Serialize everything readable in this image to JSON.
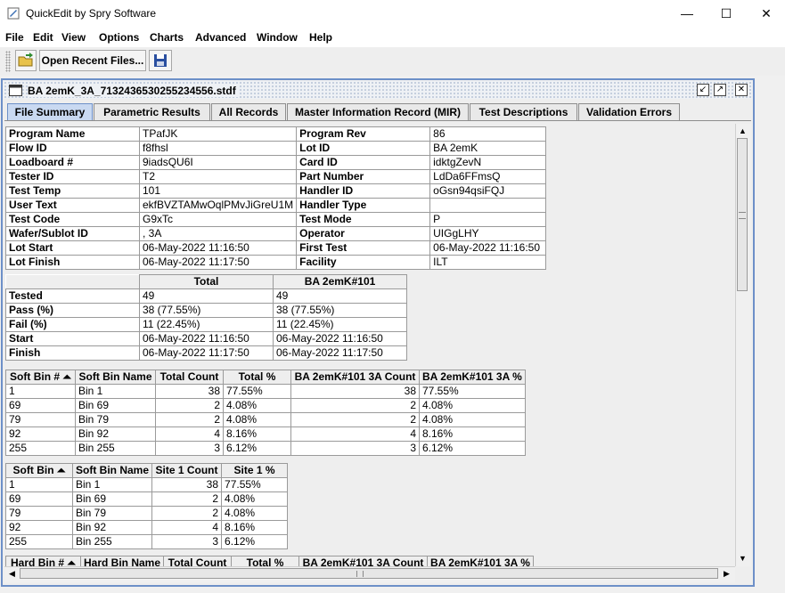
{
  "window": {
    "title": "QuickEdit by Spry Software",
    "minimize": "—",
    "maximize": "☐",
    "close": "✕"
  },
  "menu": [
    "File",
    "Edit",
    "View",
    "Options",
    "Charts",
    "Advanced",
    "Window",
    "Help"
  ],
  "toolbar": {
    "open_recent_label": "Open Recent Files..."
  },
  "frame": {
    "title": "BA 2emK_3A_7132436530255234556.stdf"
  },
  "tabs": [
    "File Summary",
    "Parametric Results",
    "All Records",
    "Master Information Record (MIR)",
    "Test Descriptions",
    "Validation Errors"
  ],
  "mir": {
    "rows": [
      [
        "Program Name",
        "TPafJK",
        "Program Rev",
        "86"
      ],
      [
        "Flow ID",
        "f8fhsl",
        "Lot ID",
        "BA 2emK"
      ],
      [
        "Loadboard #",
        "9iadsQU6I",
        "Card ID",
        "idktgZevN"
      ],
      [
        "Tester ID",
        "T2",
        "Part Number",
        "LdDa6FFmsQ"
      ],
      [
        "Test Temp",
        "101",
        "Handler ID",
        "oGsn94qsiFQJ"
      ],
      [
        "User Text",
        "ekfBVZTAMwOqlPMvJiGreU1M",
        "Handler Type",
        ""
      ],
      [
        "Test Code",
        "G9xTc",
        "Test Mode",
        "P"
      ],
      [
        "Wafer/Sublot ID",
        ", 3A",
        "Operator",
        "UIGgLHY"
      ],
      [
        "Lot Start",
        "06-May-2022 11:16:50",
        "First Test",
        "06-May-2022 11:16:50"
      ],
      [
        "Lot Finish",
        "06-May-2022 11:17:50",
        "Facility",
        "ILT"
      ]
    ]
  },
  "summary": {
    "headers": [
      "",
      "Total",
      "BA 2emK#101"
    ],
    "rows": [
      [
        "Tested",
        "49",
        "49"
      ],
      [
        "Pass (%)",
        "38 (77.55%)",
        "38 (77.55%)"
      ],
      [
        "Fail (%)",
        "11 (22.45%)",
        "11 (22.45%)"
      ],
      [
        "Start",
        "06-May-2022 11:16:50",
        "06-May-2022 11:16:50"
      ],
      [
        "Finish",
        "06-May-2022 11:17:50",
        "06-May-2022 11:17:50"
      ]
    ]
  },
  "softbin1": {
    "headers": [
      "Soft Bin # ⏶",
      "Soft Bin Name",
      "Total Count",
      "Total %",
      "BA 2emK#101 3A Count",
      "BA 2emK#101 3A %"
    ],
    "rows": [
      [
        "1",
        "Bin 1",
        "38",
        "77.55%",
        "38",
        "77.55%"
      ],
      [
        "69",
        "Bin 69",
        "2",
        "4.08%",
        "2",
        "4.08%"
      ],
      [
        "79",
        "Bin 79",
        "2",
        "4.08%",
        "2",
        "4.08%"
      ],
      [
        "92",
        "Bin 92",
        "4",
        "8.16%",
        "4",
        "8.16%"
      ],
      [
        "255",
        "Bin 255",
        "3",
        "6.12%",
        "3",
        "6.12%"
      ]
    ]
  },
  "softbin2": {
    "headers": [
      "Soft Bin ⏶",
      "Soft Bin Name",
      "Site 1 Count",
      "Site 1 %"
    ],
    "rows": [
      [
        "1",
        "Bin 1",
        "38",
        "77.55%"
      ],
      [
        "69",
        "Bin 69",
        "2",
        "4.08%"
      ],
      [
        "79",
        "Bin 79",
        "2",
        "4.08%"
      ],
      [
        "92",
        "Bin 92",
        "4",
        "8.16%"
      ],
      [
        "255",
        "Bin 255",
        "3",
        "6.12%"
      ]
    ]
  },
  "hardbin": {
    "headers": [
      "Hard Bin # ⏶",
      "Hard Bin Name",
      "Total Count",
      "Total %",
      "BA 2emK#101 3A Count",
      "BA 2emK#101 3A %"
    ]
  }
}
